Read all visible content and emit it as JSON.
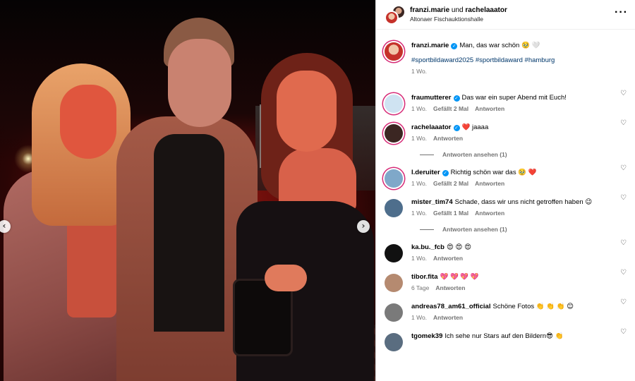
{
  "header": {
    "user1": "franzi.marie",
    "joiner": "und",
    "user2": "rachelaaator",
    "location": "Altonaer Fischauktionshalle",
    "more_icon": "more-horizontal-icon"
  },
  "photo": {
    "prev_glyph": "‹",
    "next_glyph": "›"
  },
  "caption": {
    "user": "franzi.marie",
    "text": "Man, das war schön 🥹 🤍",
    "hashtags": "#sportbildaward2025 #sportbildaward #hamburg",
    "time": "1 Wo."
  },
  "comments": [
    {
      "user": "fraumutterer",
      "verified": true,
      "text": "Das war ein super Abend mit Euch!",
      "time": "1 Wo.",
      "likes": "Gefällt 2 Mal",
      "reply": "Antworten",
      "color": "#cfe3f2"
    },
    {
      "user": "rachelaaator",
      "verified": true,
      "text": "❤️ jaaaa",
      "time": "1 Wo.",
      "likes": "",
      "reply": "Antworten",
      "color": "#3b2622",
      "thread": "Antworten ansehen (1)"
    },
    {
      "user": "l.deruiter",
      "verified": true,
      "text": "Richtig schön war das 🥹 ❤️",
      "time": "1 Wo.",
      "likes": "Gefällt 2 Mal",
      "reply": "Antworten",
      "color": "#7fa8c9"
    },
    {
      "user": "mister_tim74",
      "verified": false,
      "text": "Schade, dass wir uns nicht getroffen haben 😉",
      "time": "1 Wo.",
      "likes": "Gefällt 1 Mal",
      "reply": "Antworten",
      "color": "#4e6e8c",
      "thread": "Antworten ansehen (1)"
    },
    {
      "user": "ka.bu._fcb",
      "verified": false,
      "text": "😍 😍 😍",
      "time": "1 Wo.",
      "likes": "",
      "reply": "Antworten",
      "color": "#111111"
    },
    {
      "user": "tibor.fita",
      "verified": false,
      "text": "💖 💖 💖 💖",
      "time": "6 Tage",
      "likes": "",
      "reply": "Antworten",
      "color": "#b58a70"
    },
    {
      "user": "andreas78_am61_official",
      "verified": false,
      "text": "Schöne Fotos 👏 👏 👏 😊",
      "time": "1 Wo.",
      "likes": "",
      "reply": "Antworten",
      "color": "#7a7a7a"
    },
    {
      "user": "tgomek39",
      "verified": false,
      "text": "Ich sehe nur Stars auf den Bildern😎 👏",
      "time": "",
      "likes": "",
      "reply": "",
      "color": "#5a6d80"
    }
  ],
  "icons": {
    "heart": "heart-outline-icon",
    "verified": "verified-badge-icon"
  }
}
